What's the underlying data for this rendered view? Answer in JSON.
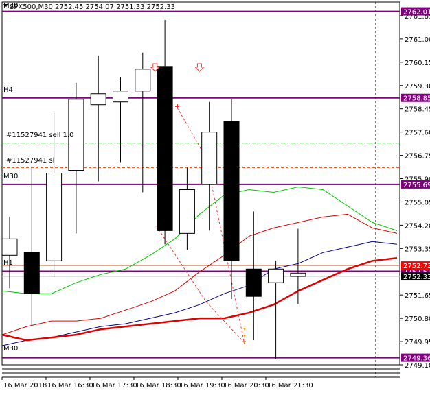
{
  "header": {
    "symbol_line": "SPX500,M30  2752.45 2754.07 2751.33 2752.33",
    "collapse_icon": "triangle-down-icon"
  },
  "level_labels": {
    "m30_top": "M30",
    "h4": "H4",
    "m30_mid": "M30",
    "h1": "H1",
    "m30_bottom": "M30"
  },
  "order_labels": {
    "sell": "#11527941 sell 1.0",
    "sl": "#11527941 sl"
  },
  "colors": {
    "level_line": "#800080",
    "price_tag_bg": "#800080",
    "candle_bull": "#ffffff",
    "candle_bear": "#000000",
    "ma_green": "#00c800",
    "ma_red_thin": "#e00000",
    "ma_blue": "#00008b",
    "ma_red_thick": "#e00000",
    "sell_order": "#008000",
    "sl_order": "#ff6020",
    "arrow_signal": "#ff3030",
    "current_price_tag": "#000000",
    "bid_tag": "#ff0000"
  },
  "chart_data": {
    "type": "candlestick",
    "symbol": "SPX500",
    "timeframe": "M30",
    "ylim": [
      2749.1,
      2762.35
    ],
    "yticks": [
      2749.1,
      2749.95,
      2750.8,
      2751.65,
      2752.5,
      2753.35,
      2754.2,
      2755.05,
      2755.9,
      2756.75,
      2757.6,
      2758.45,
      2759.3,
      2760.15,
      2761.0,
      2761.85
    ],
    "xlabels": [
      "16 Mar 2018",
      "16 Mar 16:30",
      "16 Mar 17:30",
      "16 Mar 18:30",
      "16 Mar 19:30",
      "16 Mar 20:30",
      "16 Mar 21:30"
    ],
    "candles": [
      {
        "open": 2753.1,
        "high": 2754.5,
        "low": 2751.9,
        "close": 2753.7
      },
      {
        "open": 2753.2,
        "high": 2756.3,
        "low": 2750.5,
        "close": 2751.7
      },
      {
        "open": 2752.9,
        "high": 2758.3,
        "low": 2752.3,
        "close": 2756.1
      },
      {
        "open": 2756.2,
        "high": 2759.4,
        "low": 2753.9,
        "close": 2758.8
      },
      {
        "open": 2758.6,
        "high": 2760.4,
        "low": 2755.8,
        "close": 2759.0
      },
      {
        "open": 2758.7,
        "high": 2759.6,
        "low": 2756.5,
        "close": 2759.1
      },
      {
        "open": 2759.1,
        "high": 2760.5,
        "low": 2755.4,
        "close": 2759.9
      },
      {
        "open": 2760.0,
        "high": 2761.7,
        "low": 2753.5,
        "close": 2754.0
      },
      {
        "open": 2753.9,
        "high": 2756.3,
        "low": 2753.3,
        "close": 2755.5
      },
      {
        "open": 2755.7,
        "high": 2758.7,
        "low": 2754.0,
        "close": 2757.6
      },
      {
        "open": 2758.0,
        "high": 2758.8,
        "low": 2751.5,
        "close": 2752.9
      },
      {
        "open": 2752.6,
        "high": 2754.7,
        "low": 2750.0,
        "close": 2751.6
      },
      {
        "open": 2752.1,
        "high": 2752.9,
        "low": 2749.3,
        "close": 2752.6
      },
      {
        "open": 2752.33,
        "high": 2754.07,
        "low": 2751.33,
        "close": 2752.45
      }
    ],
    "levels": [
      {
        "name": "M30",
        "price": 2762.01,
        "tag": "2762.01"
      },
      {
        "name": "H4",
        "price": 2758.85,
        "tag": "2758.85"
      },
      {
        "name": "M30",
        "price": 2755.69,
        "tag": "2755.69"
      },
      {
        "name": "H1",
        "price": 2752.52,
        "tag": "2752.52"
      },
      {
        "name": "M30",
        "price": 2749.36,
        "tag": "2749.36"
      }
    ],
    "order_lines": [
      {
        "label": "#11527941 sell 1.0",
        "price": 2757.2
      },
      {
        "label": "#11527941 sl",
        "price": 2756.3
      }
    ],
    "current_price_tags": [
      {
        "price": 2752.73,
        "tag": "2752.73"
      },
      {
        "price": 2752.33,
        "tag": "2752.33"
      }
    ],
    "moving_averages": [
      {
        "name": "ma-green",
        "values": [
          2751.8,
          2751.7,
          2751.7,
          2752.1,
          2752.4,
          2752.6,
          2753.1,
          2753.7,
          2754.6,
          2755.3,
          2755.5,
          2755.4,
          2755.6,
          2755.5,
          2754.9,
          2754.3,
          2754.0
        ]
      },
      {
        "name": "ma-red-thin",
        "values": [
          2750.2,
          2750.5,
          2750.7,
          2750.7,
          2750.8,
          2751.1,
          2751.4,
          2751.8,
          2752.5,
          2753.1,
          2753.8,
          2754.1,
          2754.3,
          2754.5,
          2754.6,
          2754.1,
          2753.9
        ]
      },
      {
        "name": "ma-blue",
        "values": [
          2749.8,
          2750.0,
          2750.1,
          2750.3,
          2750.5,
          2750.6,
          2750.8,
          2751.0,
          2751.3,
          2751.7,
          2752.0,
          2752.6,
          2752.8,
          2753.2,
          2753.4,
          2753.6,
          2753.5
        ]
      },
      {
        "name": "ma-red-thick",
        "values": [
          2750.2,
          2750.0,
          2750.1,
          2750.2,
          2750.4,
          2750.5,
          2750.6,
          2750.7,
          2750.8,
          2750.8,
          2751.0,
          2751.3,
          2751.8,
          2752.2,
          2752.6,
          2752.9,
          2753.0
        ]
      }
    ],
    "signal_arrows": [
      {
        "candle": 6,
        "direction": "down"
      },
      {
        "candle": 8,
        "direction": "down"
      }
    ]
  }
}
